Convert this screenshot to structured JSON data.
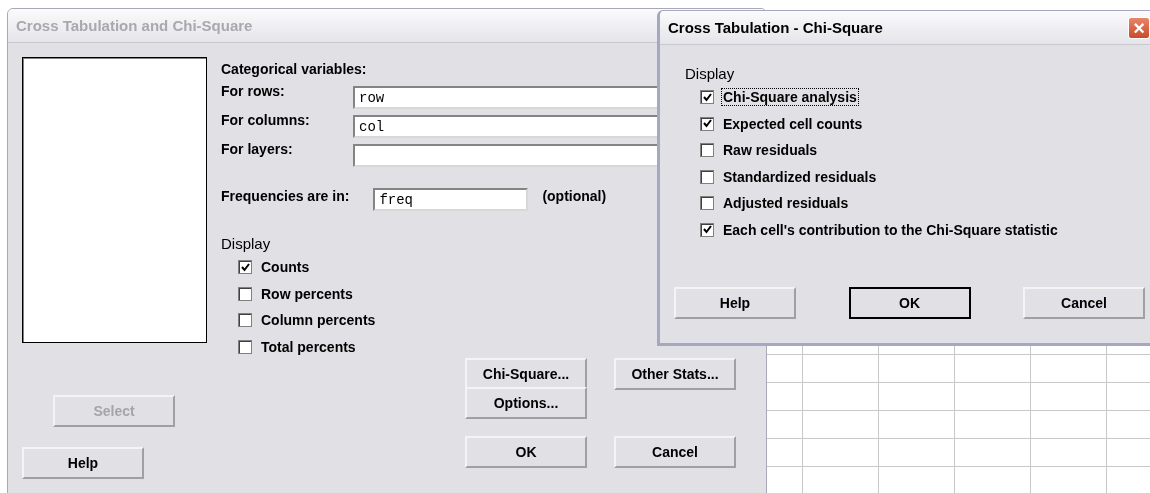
{
  "main_dialog": {
    "title": "Cross Tabulation and Chi-Square",
    "variables_heading": "Categorical variables:",
    "fields": [
      {
        "label": "For rows:",
        "value": "row"
      },
      {
        "label": "For columns:",
        "value": "col"
      },
      {
        "label": "For layers:"
      }
    ],
    "frequencies": {
      "label": "Frequencies are in:",
      "value": "freq",
      "note": "(optional)"
    },
    "display_heading": "Display",
    "display_options": [
      {
        "label": "Counts",
        "checked": true
      },
      {
        "label": "Row percents",
        "checked": false
      },
      {
        "label": "Column percents",
        "checked": false
      },
      {
        "label": "Total percents",
        "checked": false
      }
    ],
    "select_button": {
      "label": "Select",
      "disabled": true
    },
    "buttons": {
      "chi_square": "Chi-Square...",
      "other_stats": "Other Stats...",
      "options": "Options...",
      "help": "Help",
      "ok": "OK",
      "cancel": "Cancel"
    }
  },
  "sub_dialog": {
    "title": "Cross Tabulation - Chi-Square",
    "close": "×",
    "display_heading": "Display",
    "options": [
      {
        "label": "Chi-Square analysis",
        "checked": true,
        "focused": true
      },
      {
        "label": "Expected cell counts",
        "checked": true,
        "focused": false
      },
      {
        "label": "Raw residuals",
        "checked": false,
        "focused": false
      },
      {
        "label": "Standardized residuals",
        "checked": false,
        "focused": false
      },
      {
        "label": "Adjusted residuals",
        "checked": false,
        "focused": false
      },
      {
        "label": "Each cell's contribution to the Chi-Square statistic",
        "checked": true,
        "focused": false
      }
    ],
    "buttons": [
      {
        "label": "Help",
        "default": false
      },
      {
        "label": "OK",
        "default": true
      },
      {
        "label": "Cancel",
        "default": false
      }
    ]
  }
}
